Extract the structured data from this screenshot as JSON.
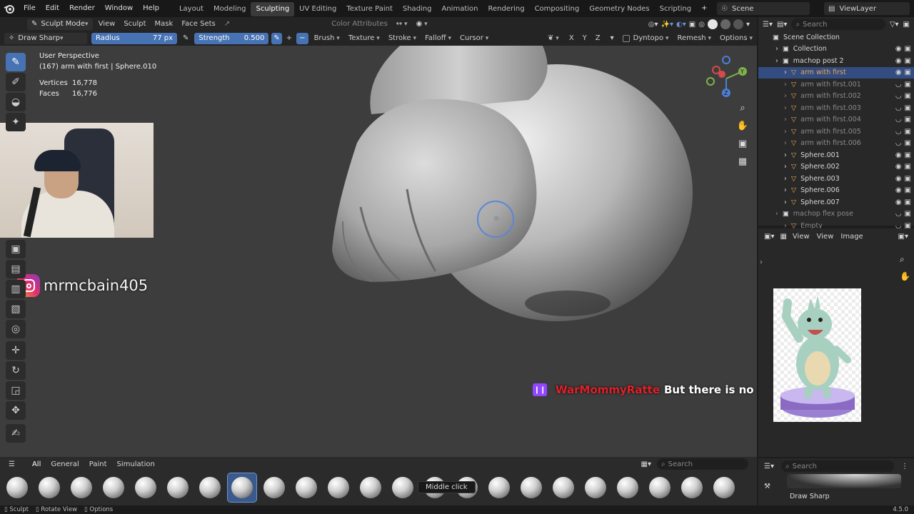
{
  "topbar": {
    "menus": [
      "File",
      "Edit",
      "Render",
      "Window",
      "Help"
    ],
    "workspaces": [
      "Layout",
      "Modeling",
      "Sculpting",
      "UV Editing",
      "Texture Paint",
      "Shading",
      "Animation",
      "Rendering",
      "Compositing",
      "Geometry Nodes",
      "Scripting"
    ],
    "active_workspace": "Sculpting",
    "scene": "Scene",
    "view_layer": "ViewLayer"
  },
  "header": {
    "mode": "Sculpt Mode",
    "menus": [
      "View",
      "Sculpt",
      "Mask",
      "Face Sets"
    ],
    "color_attributes": "Color Attributes"
  },
  "tool_settings": {
    "brush_name": "Draw Sharp",
    "radius_label": "Radius",
    "radius_value": "77 px",
    "strength_label": "Strength",
    "strength_value": "0.500",
    "menus": [
      "Brush",
      "Texture",
      "Stroke",
      "Falloff",
      "Cursor"
    ],
    "axes": [
      "X",
      "Y",
      "Z"
    ],
    "dyntopo": "Dyntopo",
    "remesh": "Remesh",
    "options": "Options"
  },
  "viewport_info": {
    "perspective": "User Perspective",
    "object": "(167) arm with first | Sphere.010",
    "vertices_label": "Vertices",
    "vertices_value": "16,778",
    "faces_label": "Faces",
    "faces_value": "16,776"
  },
  "instagram_handle": "mrmcbain405",
  "twitch": {
    "username": "WarMommyRatte",
    "message": "But there is no good or bad ending"
  },
  "outliner": {
    "search_placeholder": "Search",
    "root": "Scene Collection",
    "items": [
      {
        "label": "Collection",
        "indent": 1,
        "state": "normal"
      },
      {
        "label": "machop post 2",
        "indent": 1,
        "state": "normal"
      },
      {
        "label": "arm with first",
        "indent": 2,
        "state": "selected"
      },
      {
        "label": "arm with first.001",
        "indent": 2,
        "state": "dim"
      },
      {
        "label": "arm with first.002",
        "indent": 2,
        "state": "dim"
      },
      {
        "label": "arm with first.003",
        "indent": 2,
        "state": "dim"
      },
      {
        "label": "arm with first.004",
        "indent": 2,
        "state": "dim"
      },
      {
        "label": "arm with first.005",
        "indent": 2,
        "state": "dim"
      },
      {
        "label": "arm with first.006",
        "indent": 2,
        "state": "dim"
      },
      {
        "label": "Sphere.001",
        "indent": 2,
        "state": "normal"
      },
      {
        "label": "Sphere.002",
        "indent": 2,
        "state": "normal"
      },
      {
        "label": "Sphere.003",
        "indent": 2,
        "state": "normal"
      },
      {
        "label": "Sphere.006",
        "indent": 2,
        "state": "normal"
      },
      {
        "label": "Sphere.007",
        "indent": 2,
        "state": "normal"
      },
      {
        "label": "machop flex pose",
        "indent": 1,
        "state": "dim"
      },
      {
        "label": "Empty",
        "indent": 2,
        "state": "dim"
      }
    ]
  },
  "image_editor": {
    "menus": [
      "View",
      "View",
      "Image"
    ]
  },
  "asset_shelf": {
    "tabs": [
      "All",
      "General",
      "Paint",
      "Simulation"
    ],
    "active_tab": "All",
    "search_placeholder": "Search",
    "tooltip": "Middle click",
    "active_brush": "Draw Sharp"
  },
  "statusbar": {
    "items": [
      "Sculpt",
      "Rotate View",
      "Options"
    ],
    "version": "4.5.0"
  },
  "colors": {
    "accent": "#4772b3",
    "selected_row": "#334d80",
    "viewport_bg": "#3d3d3d",
    "twitch_purple": "#9146ff",
    "twitch_name": "#e0202a"
  }
}
